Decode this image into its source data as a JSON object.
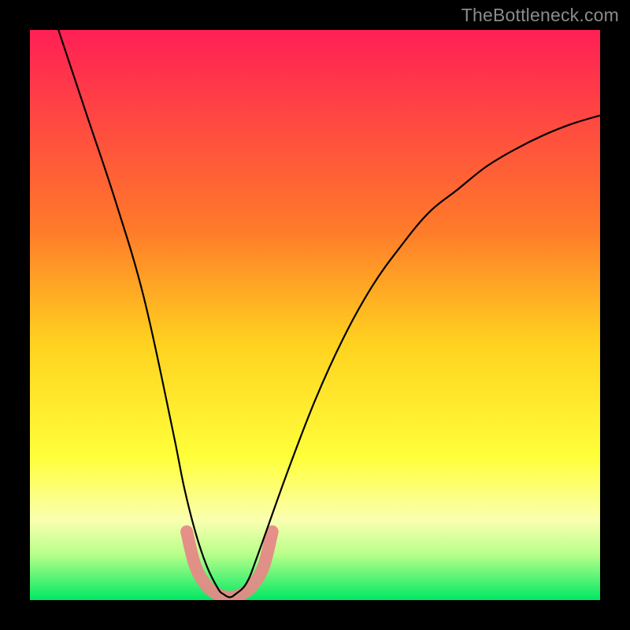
{
  "watermark": "TheBottleneck.com",
  "chart_data": {
    "type": "line",
    "title": "",
    "xlabel": "",
    "ylabel": "",
    "xlim": [
      0,
      100
    ],
    "ylim": [
      0,
      100
    ],
    "gradient_stops": [
      {
        "offset": 0,
        "color": "#ff1f55"
      },
      {
        "offset": 35,
        "color": "#ff7a2a"
      },
      {
        "offset": 55,
        "color": "#ffd21f"
      },
      {
        "offset": 75,
        "color": "#ffff3a"
      },
      {
        "offset": 86,
        "color": "#faffb0"
      },
      {
        "offset": 92,
        "color": "#b7ff8a"
      },
      {
        "offset": 100,
        "color": "#00e864"
      }
    ],
    "series": [
      {
        "name": "bottleneck-curve",
        "color": "#000000",
        "x": [
          5,
          10,
          15,
          20,
          25,
          27,
          29,
          31,
          33,
          34,
          35,
          36,
          38,
          40,
          45,
          50,
          55,
          60,
          65,
          70,
          75,
          80,
          85,
          90,
          95,
          100
        ],
        "y": [
          100,
          85,
          70,
          53,
          30,
          20,
          12,
          6,
          2,
          1,
          0.5,
          1,
          3,
          8,
          22,
          35,
          46,
          55,
          62,
          68,
          72,
          76,
          79,
          81.5,
          83.5,
          85
        ]
      }
    ],
    "highlight_band": {
      "color": "#e58a87",
      "x": [
        27.5,
        29,
        31,
        33,
        35,
        37,
        39,
        41,
        42.5
      ],
      "y": [
        12,
        6,
        2.5,
        1,
        0.5,
        1,
        2.5,
        6,
        12
      ]
    }
  }
}
